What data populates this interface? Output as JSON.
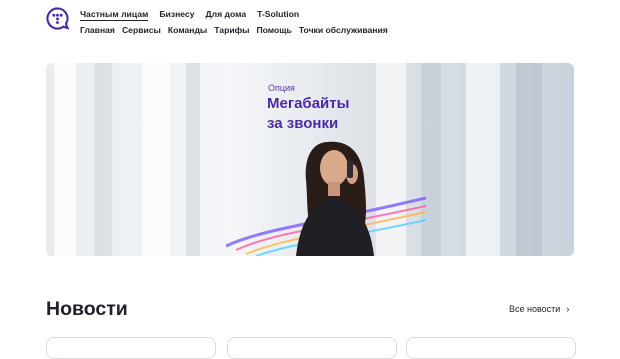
{
  "header": {
    "logo": "tele2-style-logo-icon",
    "top_nav": [
      "Частным лицам",
      "Бизнесу",
      "Для дома",
      "T-Solution"
    ],
    "sub_nav": [
      "Главная",
      "Сервисы",
      "Команды",
      "Тарифы",
      "Помощь",
      "Точки обслуживания"
    ]
  },
  "banner": {
    "kicker": "Опция",
    "headline_line1": "Мегабайты",
    "headline_line2": "за звонки"
  },
  "news": {
    "title": "Новости",
    "all_link": "Все новости"
  },
  "colors": {
    "brand": "#4b2aa3",
    "text": "#1f2229"
  }
}
